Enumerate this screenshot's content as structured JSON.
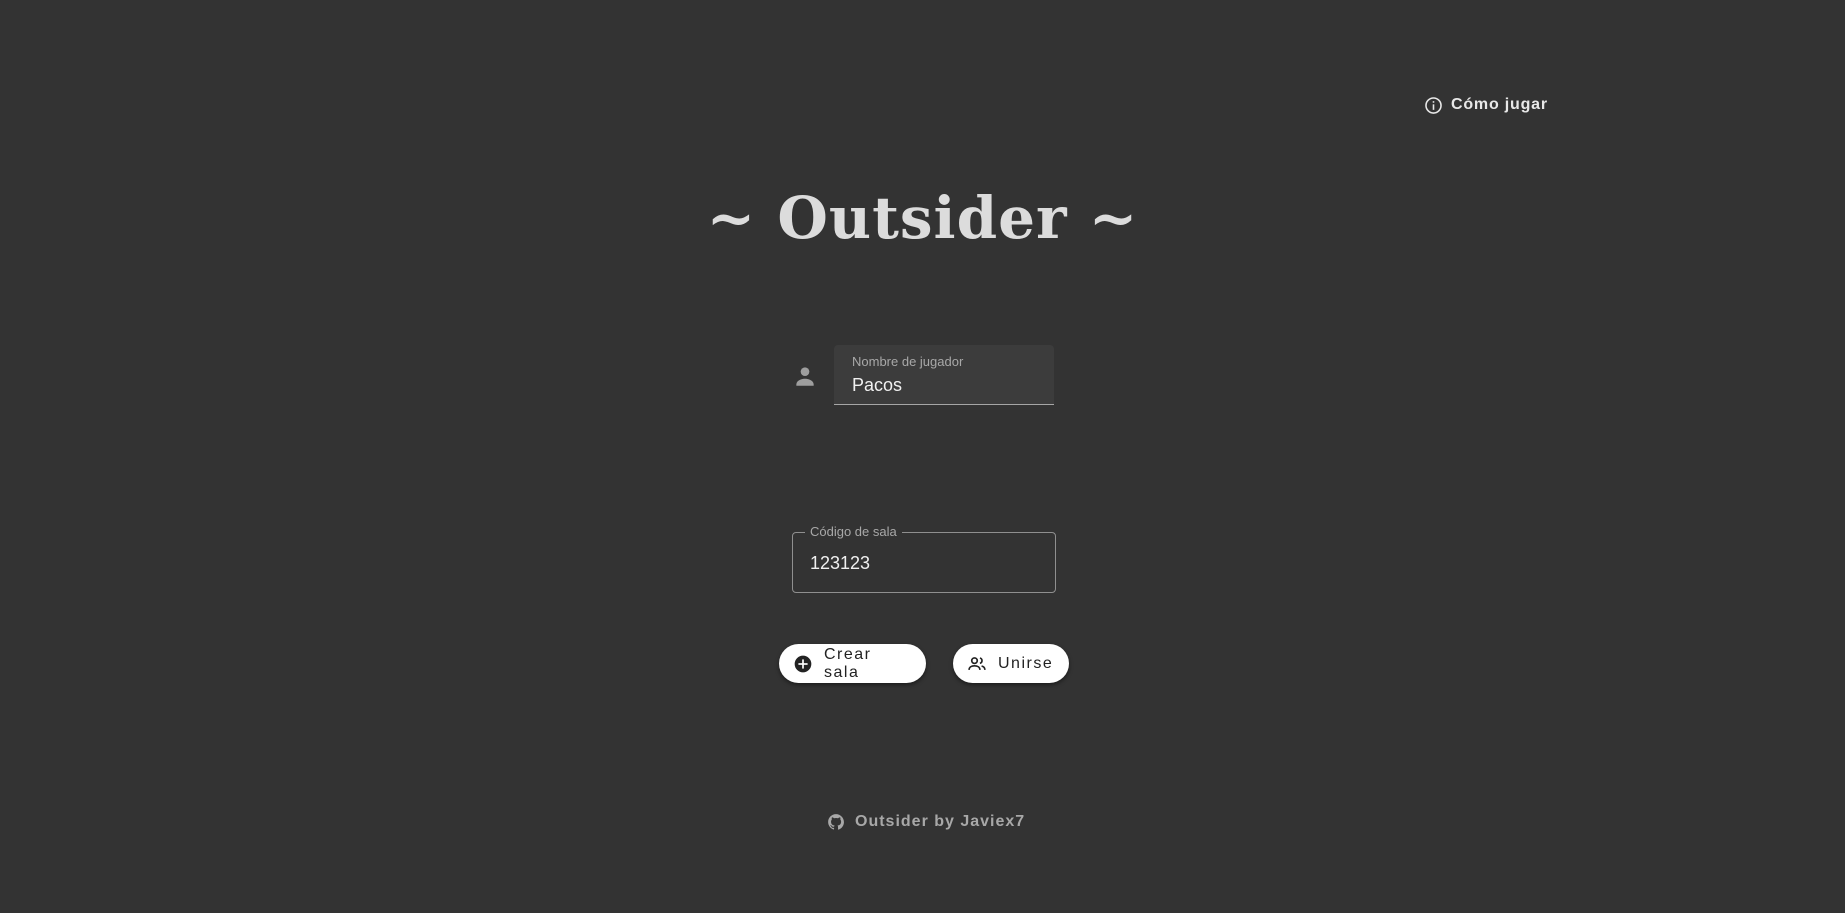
{
  "header": {
    "help_label": "Cómo jugar",
    "help_icon": "info-icon"
  },
  "title": "~ Outsider ~",
  "player_field": {
    "icon": "person-icon",
    "label": "Nombre de jugador",
    "value": "Pacos"
  },
  "room_field": {
    "label": "Código de sala",
    "value": "123123"
  },
  "actions": {
    "create_label": "Crear sala",
    "create_icon": "add-circle-icon",
    "join_label": "Unirse",
    "join_icon": "group-icon"
  },
  "footer": {
    "label": "Outsider by Javiex7",
    "icon": "github-icon"
  },
  "colors": {
    "background": "#333333",
    "button": "#ffffff",
    "text": "#e0e0e0",
    "muted": "#a8a8a8"
  }
}
